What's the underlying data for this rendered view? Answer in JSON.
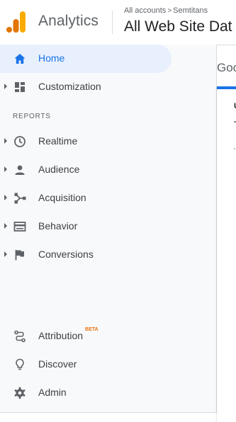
{
  "header": {
    "brand": "Analytics",
    "breadcrumb": [
      "All accounts",
      "Semtitans"
    ],
    "breadcrumb_separator": ">",
    "property": "All Web Site Dat",
    "logo_colors": [
      "#f9ab00",
      "#e37400"
    ]
  },
  "sidebar": {
    "top_items": [
      {
        "label": "Home",
        "icon": "home-icon",
        "active": true
      },
      {
        "label": "Customization",
        "icon": "dashboard-icon",
        "expandable": true
      }
    ],
    "section_label": "REPORTS",
    "report_items": [
      {
        "label": "Realtime",
        "icon": "clock-icon"
      },
      {
        "label": "Audience",
        "icon": "person-icon"
      },
      {
        "label": "Acquisition",
        "icon": "acquisition-icon"
      },
      {
        "label": "Behavior",
        "icon": "behavior-icon"
      },
      {
        "label": "Conversions",
        "icon": "flag-icon"
      }
    ],
    "bottom_items": [
      {
        "label": "Attribution",
        "badge": "BETA",
        "icon": "attribution-icon"
      },
      {
        "label": "Discover",
        "icon": "lightbulb-icon"
      },
      {
        "label": "Admin",
        "icon": "gear-icon"
      }
    ]
  },
  "main": {
    "title": "Goo",
    "card": {
      "line1": "U",
      "line2": "T",
      "line3": "'"
    }
  },
  "colors": {
    "accent": "#1a73e8",
    "active_bg": "#e8f0fe",
    "beta": "#e8710a"
  }
}
